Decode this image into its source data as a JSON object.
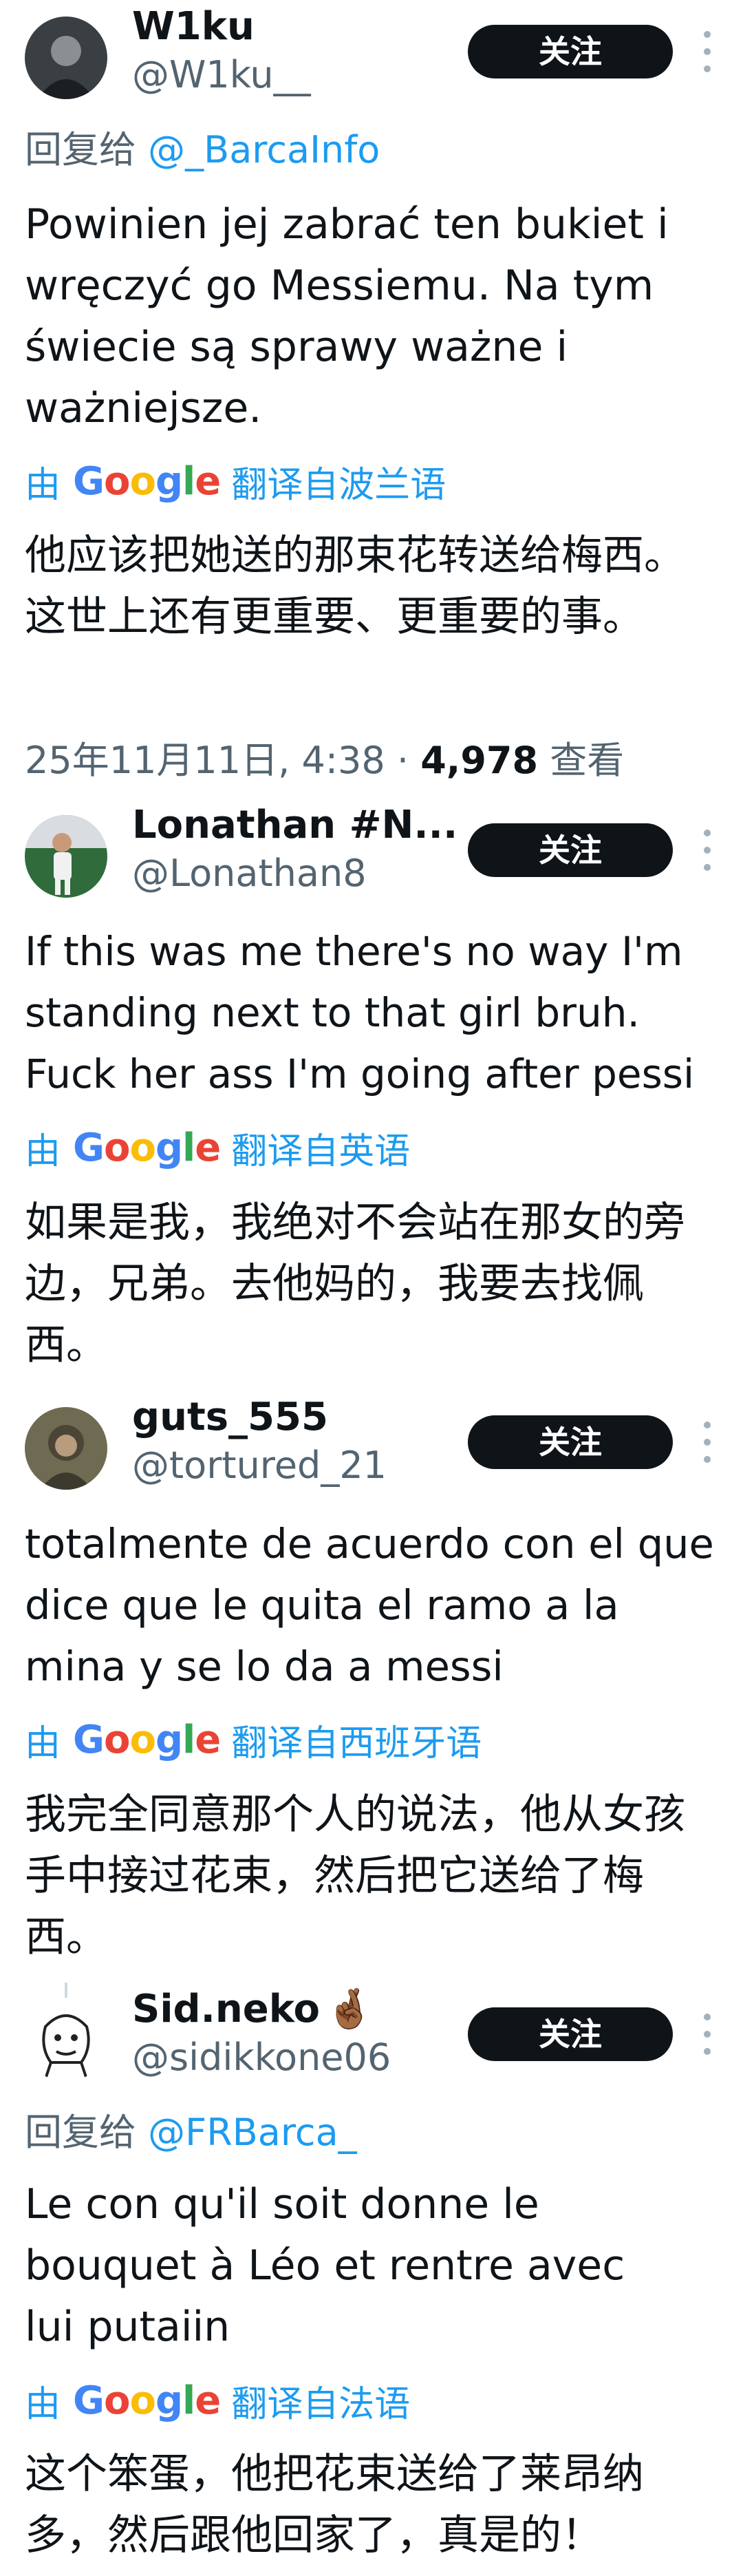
{
  "colors": {
    "link": "#1d9bf0",
    "secondary": "#536471",
    "text": "#0f1419",
    "button": "#0f1419"
  },
  "icons": {
    "more": "more-vertical-icon",
    "google": "google-logo"
  },
  "tweets": [
    {
      "name": "W1ku",
      "handle": "@W1ku__",
      "follow_label": "关注",
      "reply_prefix": "回复给",
      "reply_to": "@_BarcaInfo",
      "text": "Powinien jej zabrać ten bukiet i wręczyć go Messiemu. Na tym świecie są sprawy ważne i ważniejsze.",
      "translate_by": "由",
      "google": "Google",
      "translate_from": "翻译自波兰语",
      "translation": "他应该把她送的那束花转送给梅西。这世上还有更重要、更重要的事。",
      "timestamp": "25年11月11日, 4:38",
      "separator": " · ",
      "views_count": "4,978",
      "views_label": "查看"
    },
    {
      "name": "Lonathan #N...",
      "handle": "@Lonathan8",
      "follow_label": "关注",
      "text": "If this was me there's no way I'm standing next to that girl bruh. Fuck her ass I'm going after pessi",
      "translate_by": "由",
      "google": "Google",
      "translate_from": "翻译自英语",
      "translation": "如果是我，我绝对不会站在那女的旁边，兄弟。去他妈的，我要去找佩西。"
    },
    {
      "name": "guts_555",
      "handle": "@tortured_21",
      "follow_label": "关注",
      "text": "totalmente de acuerdo con el que dice que le quita el ramo a la mina y se lo da a messi",
      "translate_by": "由",
      "google": "Google",
      "translate_from": "翻译自西班牙语",
      "translation": "我完全同意那个人的说法，他从女孩手中接过花束，然后把它送给了梅西。"
    },
    {
      "name": "Sid.neko",
      "name_emoji": "🤞🏾",
      "handle": "@sidikkone06",
      "follow_label": "关注",
      "reply_prefix": "回复给",
      "reply_to": "@FRBarca_",
      "text": "Le con qu'il soit donne le bouquet à Léo et rentre avec lui putaiin",
      "translate_by": "由",
      "google": "Google",
      "translate_from": "翻译自法语",
      "translation": "这个笨蛋，他把花束送给了莱昂纳多，然后跟他回家了，真是的！"
    }
  ]
}
